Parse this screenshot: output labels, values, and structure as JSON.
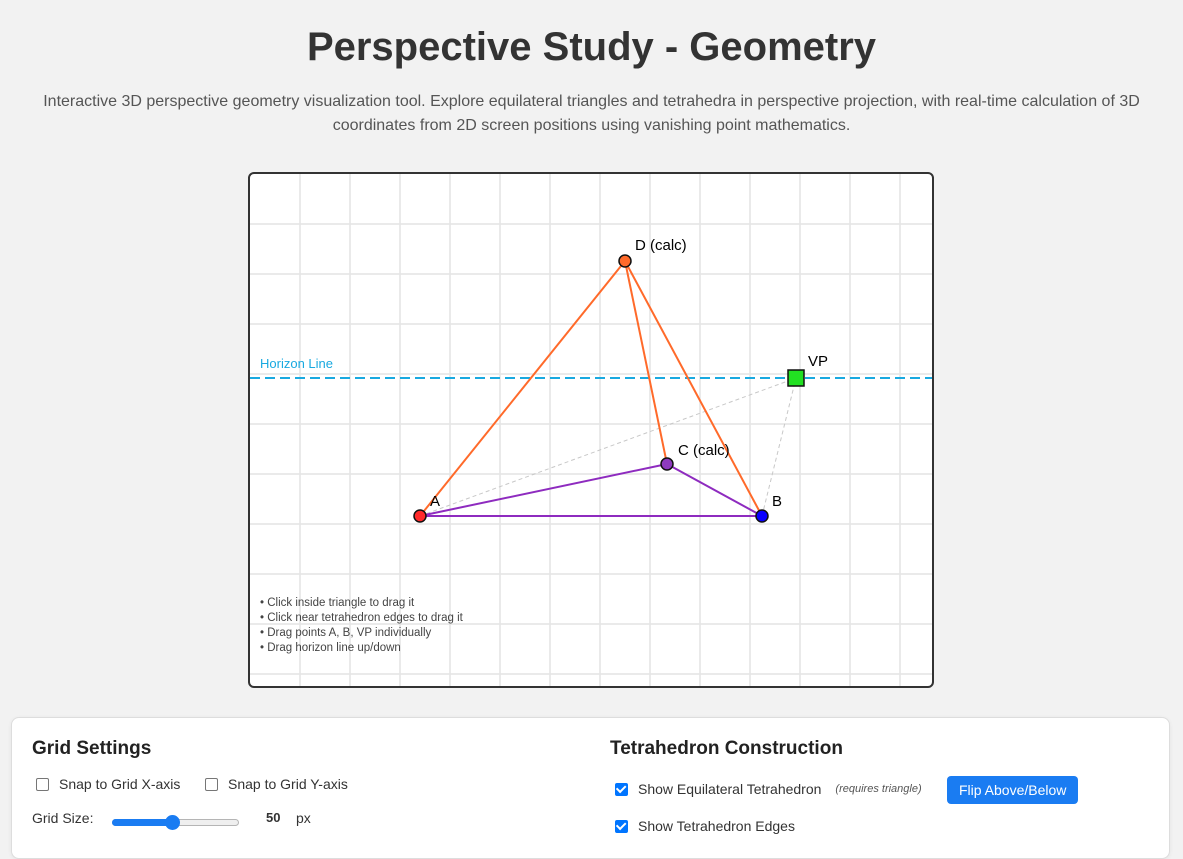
{
  "page": {
    "title": "Perspective Study - Geometry",
    "description": "Interactive 3D perspective geometry visualization tool. Explore equilateral triangles and tetrahedra in perspective projection, with real-time calculation of 3D coordinates from 2D screen positions using vanishing point mathematics."
  },
  "canvas": {
    "horizon_label": "Horizon Line",
    "points": {
      "A": {
        "label": "A",
        "color": "#ff2a2a"
      },
      "B": {
        "label": "B",
        "color": "#0a00ff"
      },
      "C": {
        "label": "C (calc)",
        "color": "#8e3bbf"
      },
      "D": {
        "label": "D (calc)",
        "color": "#ff6a2a"
      },
      "VP": {
        "label": "VP",
        "color": "#22e022"
      }
    },
    "colors": {
      "horizon": "#19a9e0",
      "tetra_edge": "#ff6a2a",
      "triangle_edge": "#8e2bbf",
      "guide": "#c8c8c8",
      "grid": "#e4e4e4"
    },
    "instructions": [
      "• Click inside triangle to drag it",
      "• Click near tetrahedron edges to drag it",
      "• Drag points A, B, VP individually",
      "• Drag horizon line up/down"
    ]
  },
  "grid_settings": {
    "title": "Grid Settings",
    "snap_x_label": "Snap to Grid X-axis",
    "snap_x_checked": false,
    "snap_y_label": "Snap to Grid Y-axis",
    "snap_y_checked": false,
    "grid_size_label": "Grid Size:",
    "grid_size_value": "50",
    "grid_size_unit": "px",
    "grid_size_fraction": 0.47
  },
  "tetrahedron": {
    "title": "Tetrahedron Construction",
    "show_tetra_label": "Show Equilateral Tetrahedron",
    "show_tetra_checked": true,
    "requires_hint": "(requires triangle)",
    "flip_button": "Flip Above/Below",
    "show_edges_label": "Show Tetrahedron Edges",
    "show_edges_checked": true
  }
}
